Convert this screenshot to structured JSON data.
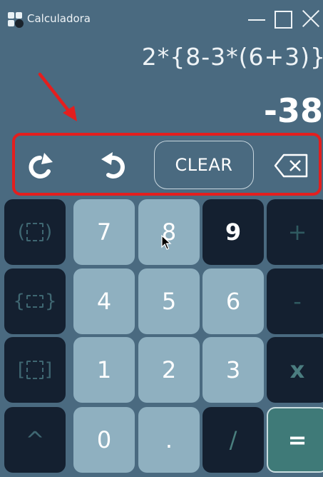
{
  "window": {
    "title": "Calculadora",
    "icon": "calculator-app-icon"
  },
  "display": {
    "expression": "2*{8-3*(6+3)}",
    "result": "-38"
  },
  "controls": {
    "redo_icon": "redo-icon",
    "undo_icon": "undo-icon",
    "clear_label": "CLEAR",
    "backspace_icon": "backspace-icon"
  },
  "keypad": {
    "rows": [
      [
        "( )",
        "7",
        "8",
        "9",
        "+"
      ],
      [
        "{ }",
        "4",
        "5",
        "6",
        "-"
      ],
      [
        "[ ]",
        "1",
        "2",
        "3",
        "x"
      ],
      [
        "^",
        "0",
        ".",
        "/",
        "="
      ]
    ]
  },
  "annotation": {
    "highlight_color": "#e41e1e"
  },
  "colors": {
    "background": "#4a6a80",
    "key_dark": "#142030",
    "key_light": "#8fb0c0",
    "key_equals": "#3f7a78"
  }
}
